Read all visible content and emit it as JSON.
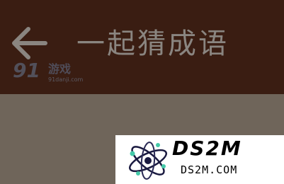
{
  "header": {
    "title": "一起猜成语",
    "back_icon": "arrow-left-icon",
    "background_color": "#3a1d12",
    "title_color": "#8a8580"
  },
  "watermark_91": {
    "logo_text": "91",
    "brand": "游戏",
    "url": "91danji.com"
  },
  "watermark_ds2m": {
    "name": "DS2M",
    "url": "DS2M.COM",
    "logo_icon": "atom-icon"
  },
  "content": {
    "background_color": "#6f655a"
  }
}
